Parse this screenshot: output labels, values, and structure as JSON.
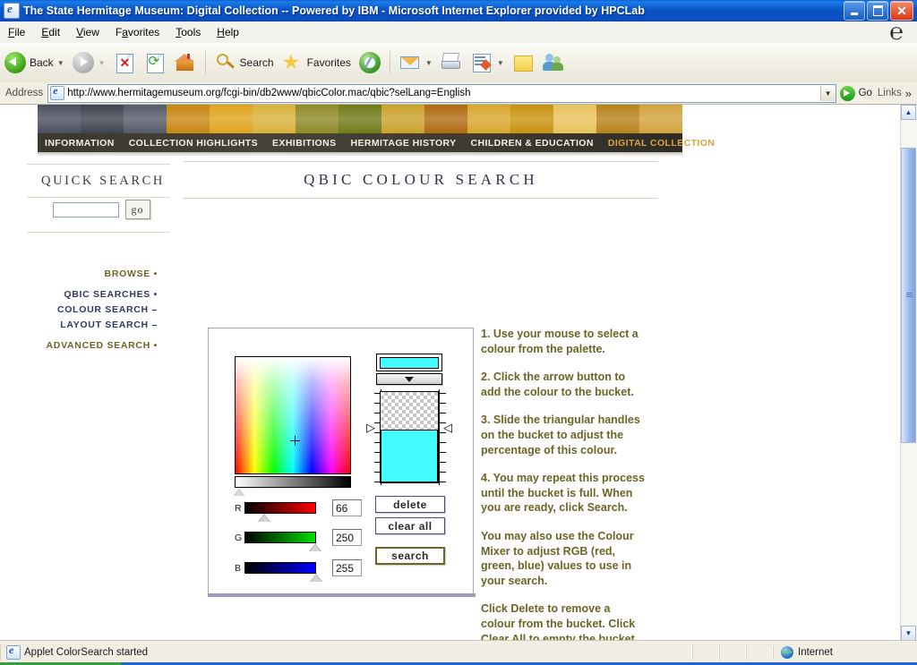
{
  "window": {
    "title": "The State Hermitage Museum: Digital Collection -- Powered by IBM - Microsoft Internet Explorer provided by HPCLab",
    "minimize_label": "Minimize",
    "maximize_label": "Restore",
    "close_label": "Close"
  },
  "menubar": {
    "items": [
      {
        "label": "File",
        "accel": "F"
      },
      {
        "label": "Edit",
        "accel": "E"
      },
      {
        "label": "View",
        "accel": "V"
      },
      {
        "label": "Favorites",
        "accel": "a"
      },
      {
        "label": "Tools",
        "accel": "T"
      },
      {
        "label": "Help",
        "accel": "H"
      }
    ]
  },
  "toolbar": {
    "back_label": "Back",
    "forward_label": "Forward",
    "stop_label": "Stop",
    "refresh_label": "Refresh",
    "home_label": "Home",
    "search_label": "Search",
    "favorites_label": "Favorites",
    "media_label": "Media",
    "mail_label": "Mail",
    "print_label": "Print",
    "edit_label": "Edit",
    "messenger_label": "Messenger",
    "notes_label": "Notes"
  },
  "address": {
    "label": "Address",
    "url": "http://www.hermitagemuseum.org/fcgi-bin/db2www/qbicColor.mac/qbic?selLang=English",
    "go_label": "Go",
    "links_label": "Links"
  },
  "site_nav": {
    "items": [
      {
        "label": "INFORMATION",
        "active": false
      },
      {
        "label": "COLLECTION HIGHLIGHTS",
        "active": false
      },
      {
        "label": "EXHIBITIONS",
        "active": false
      },
      {
        "label": "HERMITAGE HISTORY",
        "active": false
      },
      {
        "label": "CHILDREN & EDUCATION",
        "active": false
      },
      {
        "label": "DIGITAL COLLECTION",
        "active": true
      }
    ],
    "active_color": "#d9a441"
  },
  "sidebar": {
    "quick_search_title": "QUICK SEARCH",
    "quick_search_value": "",
    "quick_search_placeholder": "",
    "go_label": "go",
    "links": [
      {
        "label": "BROWSE •",
        "color": "olive"
      },
      {
        "label": "QBIC SEARCHES •",
        "color": "navy"
      },
      {
        "label": "COLOUR SEARCH –",
        "color": "navy"
      },
      {
        "label": "LAYOUT SEARCH –",
        "color": "navy"
      },
      {
        "label": "ADVANCED SEARCH •",
        "color": "olive"
      }
    ]
  },
  "content": {
    "title": "QBIC COLOUR SEARCH"
  },
  "applet": {
    "name": "ColorSearch",
    "selected_color": "#42faff",
    "rgb": [
      {
        "label": "R",
        "value": "66",
        "percent": 26,
        "track": "linear-gradient(to right,#000000,#ff0000)"
      },
      {
        "label": "G",
        "value": "250",
        "percent": 98,
        "track": "linear-gradient(to right,#000000,#00e000)"
      },
      {
        "label": "B",
        "value": "255",
        "percent": 99,
        "track": "linear-gradient(to right,#000000,#0000ff)"
      }
    ],
    "value_slider_percent": 0,
    "bucket_fill_percent": 58,
    "bucket_empty_label": "transparent",
    "add_arrow_label": "add colour to bucket",
    "buttons": [
      {
        "label": "delete",
        "style": "normal"
      },
      {
        "label": "clear all",
        "style": "normal"
      },
      {
        "label": "search",
        "style": "search"
      }
    ]
  },
  "instructions": [
    "1. Use your mouse to select a colour from the palette.",
    "2. Click the arrow button to add the colour to the bucket.",
    "3. Slide the triangular handles on the bucket to adjust the percentage of this colour.",
    "4. You may repeat this process until the bucket is full. When you are ready, click Search.",
    "You may also use the Colour Mixer to adjust RGB (red, green, blue) values to use in your search.",
    "Click Delete to remove a colour from the bucket. Click Clear All to empty the bucket."
  ],
  "statusbar": {
    "message": "Applet ColorSearch started",
    "zone": "Internet"
  },
  "banner_segments": [
    "#4a4f5e",
    "#3e4350",
    "#555a68",
    "#c8860f",
    "#e0a31c",
    "#d9b23a",
    "#8e8a26",
    "#6f7a18",
    "#caa12a",
    "#b06a10",
    "#d8a62c",
    "#c8920f",
    "#e8c25a",
    "#b8821a",
    "#d2a23c"
  ]
}
